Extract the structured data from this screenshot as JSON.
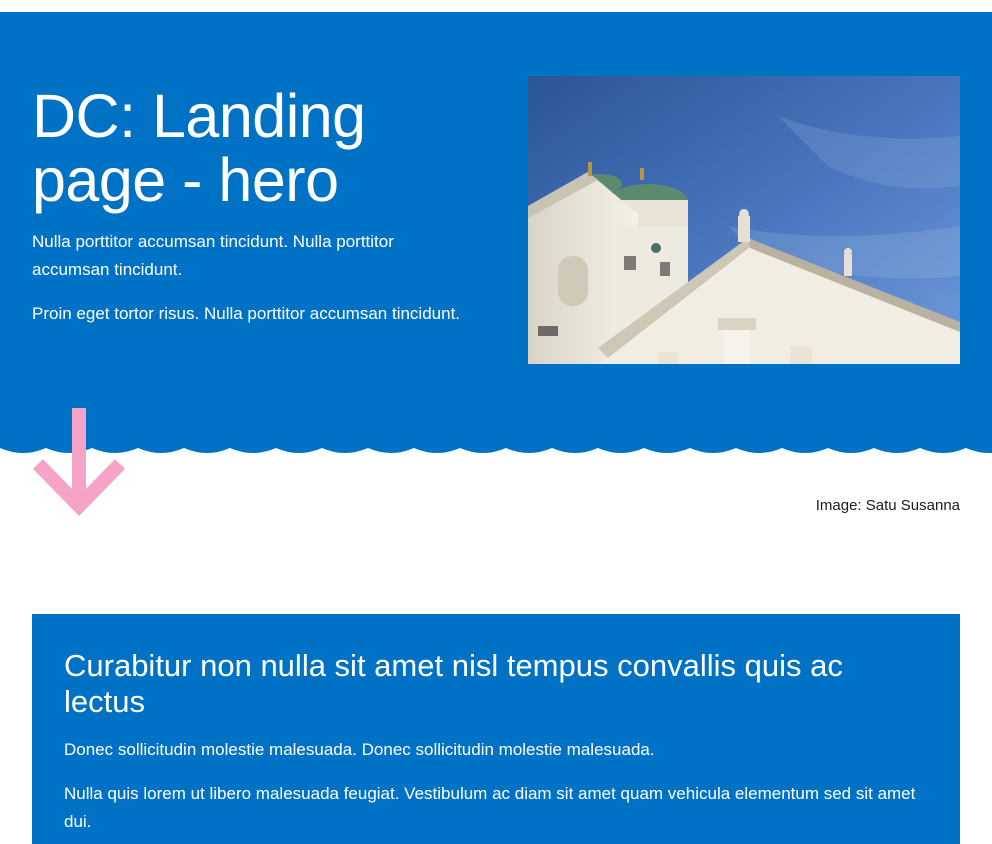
{
  "hero": {
    "title": "DC: Landing page - hero",
    "paragraphs": [
      "Nulla porttitor accumsan tincidunt. Nulla porttitor accumsan tincidunt.",
      "Proin eget tortor risus. Nulla porttitor accumsan tincidunt."
    ],
    "background_color": "#0072c6",
    "image_credit": "Image: Satu Susanna"
  },
  "decoration": {
    "arrow_icon": "arrow-down-icon",
    "arrow_color": "#f5a3c7"
  },
  "info_box": {
    "heading": "Curabitur non nulla sit amet nisl tempus convallis quis ac lectus",
    "paragraphs": [
      "Donec sollicitudin molestie malesuada. Donec sollicitudin molestie malesuada.",
      "Nulla quis lorem ut libero malesuada feugiat. Vestibulum ac diam sit amet quam vehicula elementum sed sit amet dui."
    ],
    "background_color": "#0072c6"
  }
}
